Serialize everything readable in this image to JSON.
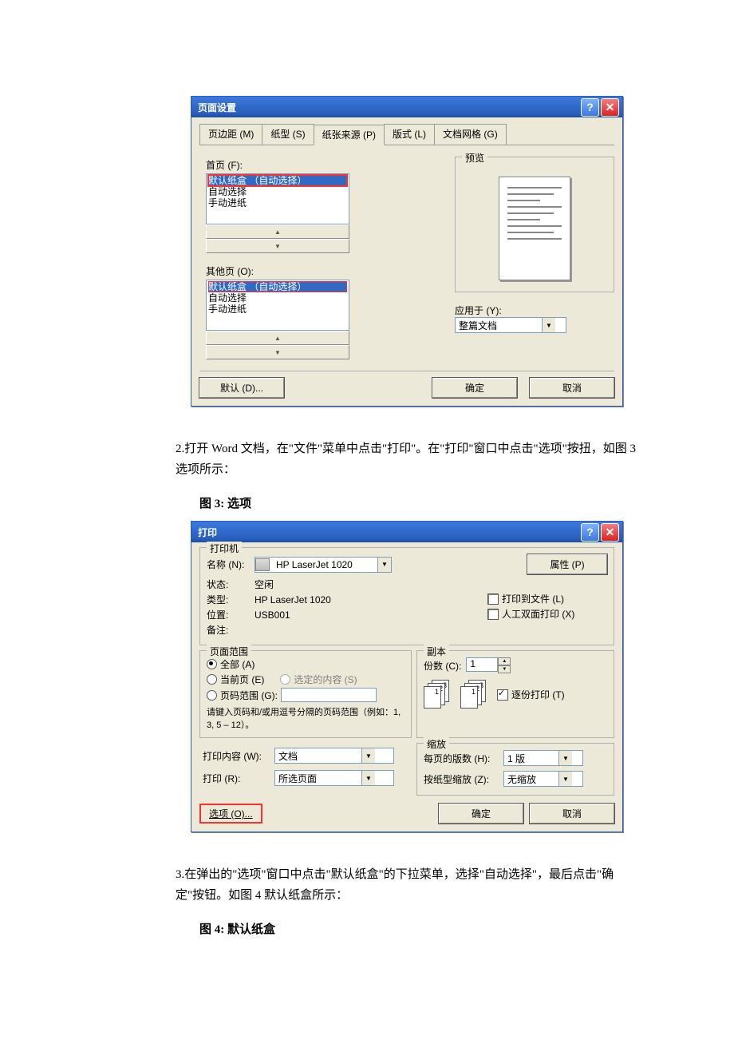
{
  "pageSetup": {
    "title": "页面设置",
    "tabs": {
      "margins": "页边距 (M)",
      "paperSize": "纸型 (S)",
      "paperSource": "纸张来源 (P)",
      "layout": "版式 (L)",
      "grid": "文档网格 (G)"
    },
    "firstPageLabel": "首页 (F):",
    "otherPagesLabel": "其他页 (O):",
    "trayOptions": {
      "default": "默认纸盒 （自动选择）",
      "auto": "自动选择",
      "manual": "手动进纸"
    },
    "previewLabel": "预览",
    "applyToLabel": "应用于 (Y):",
    "applyToValue": "整篇文档",
    "defaultBtn": "默认 (D)...",
    "okBtn": "确定",
    "cancelBtn": "取消"
  },
  "para2": "2.打开 Word 文档，在\"文件\"菜单中点击\"打印\"。在\"打印\"窗口中点击\"选项\"按扭，如图 3 选项所示：",
  "caption3": "图 3: 选项",
  "print": {
    "title": "打印",
    "printerGroup": "打印机",
    "nameLabel": "名称 (N):",
    "printerName": "HP LaserJet 1020",
    "propertiesBtn": "属性 (P)",
    "statusLabel": "状态:",
    "statusValue": "空闲",
    "typeLabel": "类型:",
    "typeValue": "HP LaserJet 1020",
    "whereLabel": "位置:",
    "whereValue": "USB001",
    "commentLabel": "备注:",
    "printToFile": "打印到文件 (L)",
    "manualDuplex": "人工双面打印 (X)",
    "rangeGroup": "页面范围",
    "rangeAll": "全部 (A)",
    "rangeCurrent": "当前页 (E)",
    "rangeSelection": "选定的内容 (S)",
    "rangePages": "页码范围 (G):",
    "rangeHint": "请键入页码和/或用逗号分隔的页码范围（例如：1, 3, 5 – 12）。",
    "copiesGroup": "副本",
    "copiesLabel": "份数 (C):",
    "copiesValue": "1",
    "collate": "逐份打印 (T)",
    "zoomGroup": "缩放",
    "pagesPerSheetLabel": "每页的版数 (H):",
    "pagesPerSheetValue": "1 版",
    "scaleToLabel": "按纸型缩放 (Z):",
    "scaleToValue": "无缩放",
    "printWhatLabel": "打印内容 (W):",
    "printWhatValue": "文档",
    "printRangeLabel": "打印 (R):",
    "printRangeValue": "所选页面",
    "optionsBtn": "选项 (O)...",
    "okBtn": "确定",
    "cancelBtn": "取消"
  },
  "para3": "3.在弹出的\"选项\"窗口中点击\"默认纸盒\"的下拉菜单，选择\"自动选择\"，最后点击\"确定\"按钮。如图 4 默认纸盒所示：",
  "caption4": "图 4: 默认纸盒"
}
